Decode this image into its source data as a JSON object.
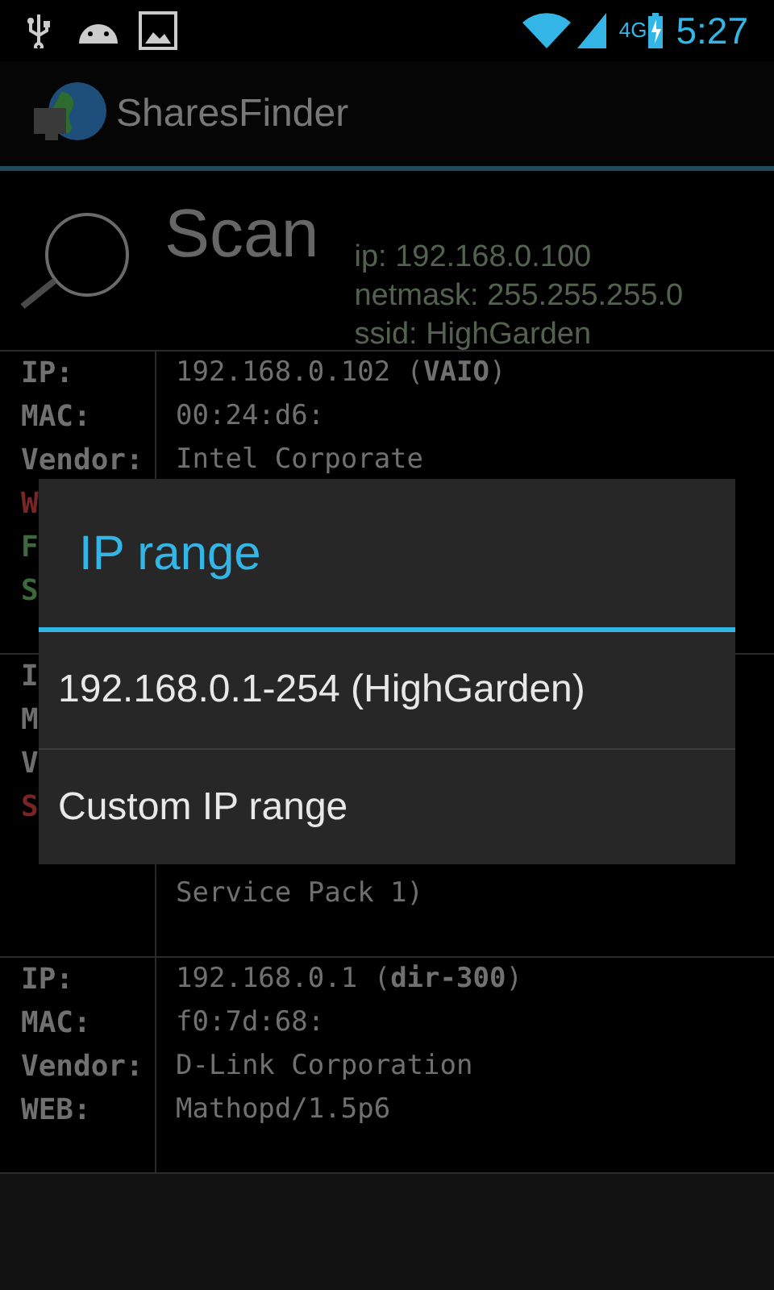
{
  "status_bar": {
    "network": "4G",
    "time": "5:27"
  },
  "action_bar": {
    "title": "SharesFinder"
  },
  "scan": {
    "title": "Scan",
    "info": [
      "ip: 192.168.0.100",
      "netmask: 255.255.255.0",
      "ssid: HighGarden"
    ]
  },
  "hosts": [
    {
      "rows": [
        {
          "kind": "field",
          "label": "IP:",
          "value": "192.168.0.102 (**VAIO**)"
        },
        {
          "kind": "field",
          "label": "MAC:",
          "value": "00:24:d6:"
        },
        {
          "kind": "field",
          "label": "Vendor:",
          "value": "Intel Corporate"
        },
        {
          "kind": "field",
          "label": "W",
          "color": "#7a2626"
        },
        {
          "kind": "field",
          "label": "F",
          "color": "#3d6b3d"
        },
        {
          "kind": "field",
          "label": "S",
          "color": "#3d6b3d"
        }
      ]
    },
    {
      "rows": [
        {
          "kind": "field",
          "label": "I"
        },
        {
          "kind": "field",
          "label": "M"
        },
        {
          "kind": "field",
          "label": "V"
        },
        {
          "kind": "field",
          "label": "S",
          "color": "#7a2626"
        },
        {
          "kind": "blank"
        },
        {
          "kind": "field",
          "value": "Service Pack 1)"
        }
      ]
    },
    {
      "rows": [
        {
          "kind": "field",
          "label": "IP:",
          "value": "192.168.0.1 (**dir-300**)"
        },
        {
          "kind": "field",
          "label": "MAC:",
          "value": "f0:7d:68:"
        },
        {
          "kind": "field",
          "label": "Vendor:",
          "value": "D-Link Corporation"
        },
        {
          "kind": "field",
          "label": "WEB:",
          "value": "Mathopd/1.5p6"
        }
      ]
    }
  ],
  "dialog": {
    "title": "IP range",
    "options": [
      "192.168.0.1-254 (HighGarden)",
      "Custom IP range"
    ]
  }
}
